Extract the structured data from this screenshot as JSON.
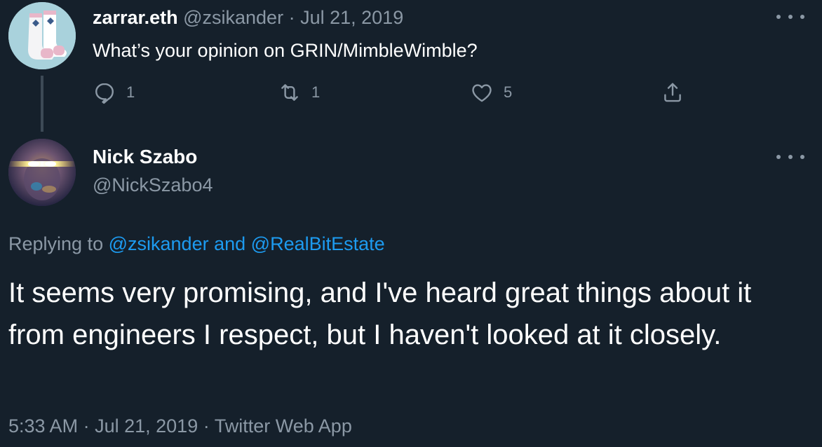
{
  "parent_tweet": {
    "display_name": "zarrar.eth",
    "handle": "@zsikander",
    "separator": "·",
    "date": "Jul 21, 2019",
    "text": "What’s your opinion on GRIN/MimbleWimble?",
    "actions": {
      "reply_count": "1",
      "retweet_count": "1",
      "like_count": "5"
    }
  },
  "main_tweet": {
    "display_name": "Nick Szabo",
    "handle": "@NickSzabo4",
    "replying_prefix": "Replying to",
    "replying_user1": "@zsikander",
    "replying_and": "and",
    "replying_user2": "@RealBitEstate",
    "text": "It seems very promising, and I've heard great things about it from engineers I respect, but I haven't looked at it closely.",
    "time": "5:33 AM",
    "separator": "·",
    "date": "Jul 21, 2019",
    "source": "Twitter Web App"
  },
  "colors": {
    "background": "#15202b",
    "secondary_text": "#8b98a5",
    "link": "#1d9bf0"
  },
  "icons": [
    "reply-icon",
    "retweet-icon",
    "like-icon",
    "share-icon",
    "more-icon"
  ]
}
